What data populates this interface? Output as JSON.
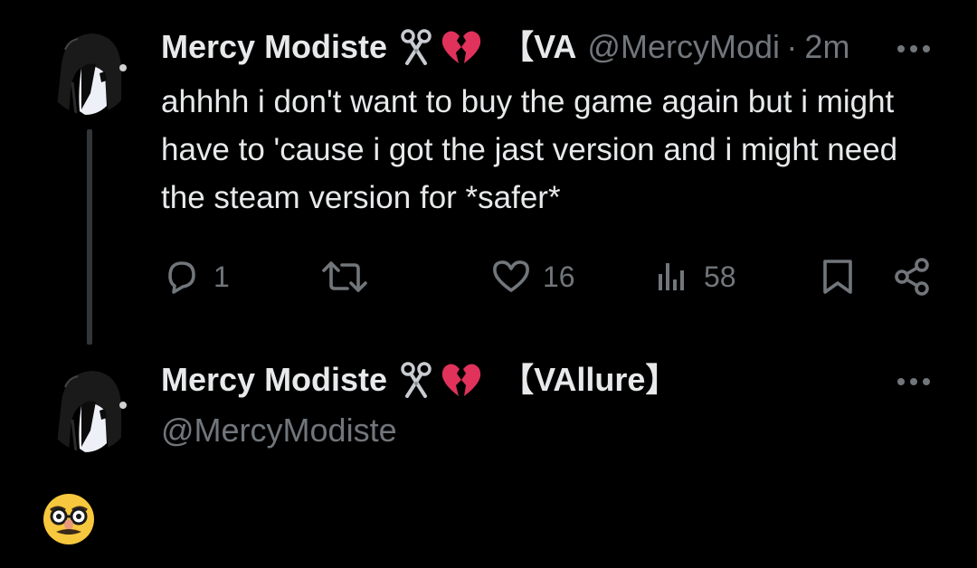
{
  "tweets": [
    {
      "display_name": "Mercy Modiste",
      "name_suffix": "【VA",
      "handle": "@MercyModiste",
      "separator": "·",
      "timestamp": "2m",
      "text": "ahhhh i don't want to buy the game again but i might have to 'cause i got the jast version and i might need the steam version for *safer*",
      "stats": {
        "replies": "1",
        "likes": "16",
        "views": "58"
      }
    },
    {
      "display_name": "Mercy Modiste",
      "name_suffix": "【VAllure】",
      "handle": "@MercyModiste"
    }
  ],
  "icons": {
    "name_badges": [
      "scissors-icon",
      "broken-heart-icon"
    ],
    "actions": [
      "reply-icon",
      "retweet-icon",
      "like-icon",
      "views-icon",
      "bookmark-icon",
      "share-icon"
    ],
    "menu": "more-icon",
    "compose_emoji": "disguised-face-emoji"
  },
  "colors": {
    "background": "#000000",
    "primary_text": "#e7e9ea",
    "secondary_text": "#71767b",
    "thread_line": "#333639",
    "broken_heart": "#e0325b",
    "emoji_yellow": "#f7c73e"
  }
}
